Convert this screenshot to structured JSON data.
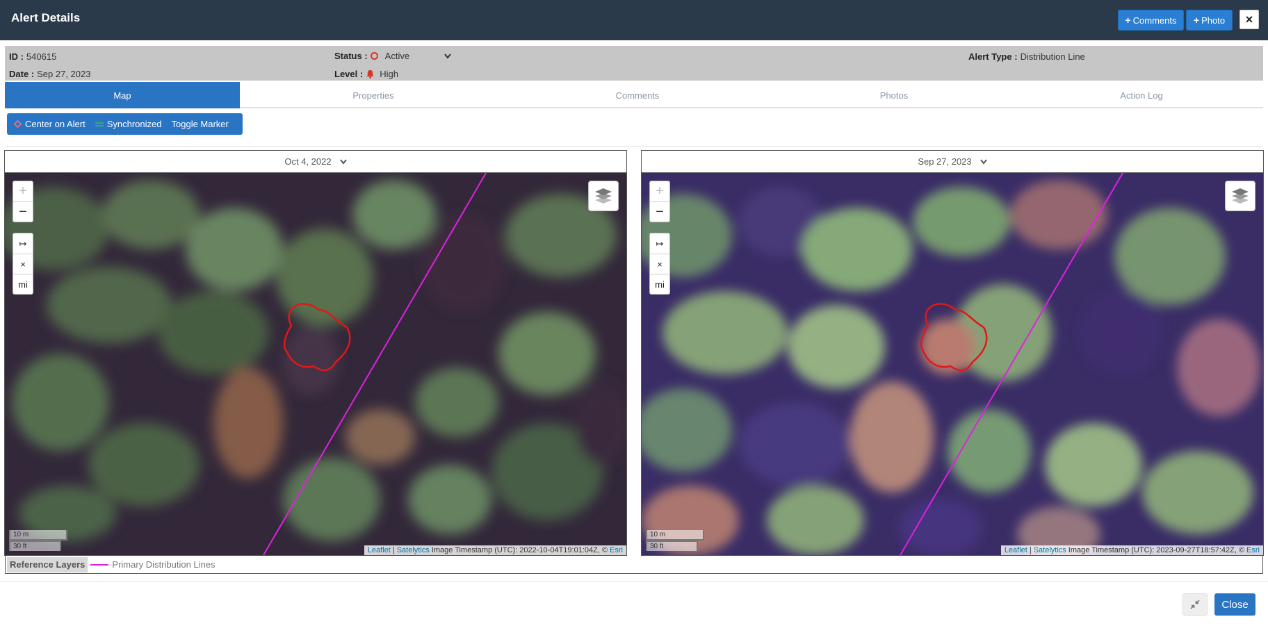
{
  "header": {
    "title": "Alert Details",
    "comments_label": "Comments",
    "photo_label": "Photo",
    "close_icon": "×"
  },
  "info": {
    "id_label": "ID :",
    "id_value": "540615",
    "date_label": "Date :",
    "date_value": "Sep 27, 2023",
    "status_label": "Status :",
    "status_value": "Active",
    "level_label": "Level :",
    "level_value": "High",
    "alert_type_label": "Alert Type :",
    "alert_type_value": "Distribution Line"
  },
  "tabs": [
    {
      "label": "Map",
      "active": true
    },
    {
      "label": "Properties",
      "active": false
    },
    {
      "label": "Comments",
      "active": false
    },
    {
      "label": "Photos",
      "active": false
    },
    {
      "label": "Action Log",
      "active": false
    }
  ],
  "toolbar": {
    "center_label": "Center on Alert",
    "sync_label": "Synchronized",
    "toggle_label": "Toggle Marker"
  },
  "maps": {
    "left": {
      "date": "Oct 4, 2022",
      "scale_m": "10 m",
      "scale_ft": "30 ft",
      "timestamp": "Image Timestamp (UTC): 2022-10-04T19:01:04Z, ©"
    },
    "right": {
      "date": "Sep 27, 2023",
      "scale_m": "10 m",
      "scale_ft": "30 ft",
      "timestamp": "Image Timestamp (UTC): 2023-09-27T18:57:42Z, ©"
    },
    "zoom_in": "+",
    "zoom_out": "−",
    "measure_icon": "↦",
    "clear_icon": "×",
    "unit_label": "mi",
    "attrib_leaflet": "Leaflet",
    "attrib_sep": "|",
    "attrib_satelytics": "Satelytics",
    "attrib_esri": "Esri"
  },
  "reference": {
    "title": "Reference Layers",
    "layer_label": "Primary Distribution Lines",
    "layer_color": "#e020e0"
  },
  "footer": {
    "close_label": "Close"
  },
  "colors": {
    "header_bg": "#2b3a4a",
    "accent": "#2a74c4",
    "alert_outline": "#e01818",
    "line": "#e020e0"
  }
}
